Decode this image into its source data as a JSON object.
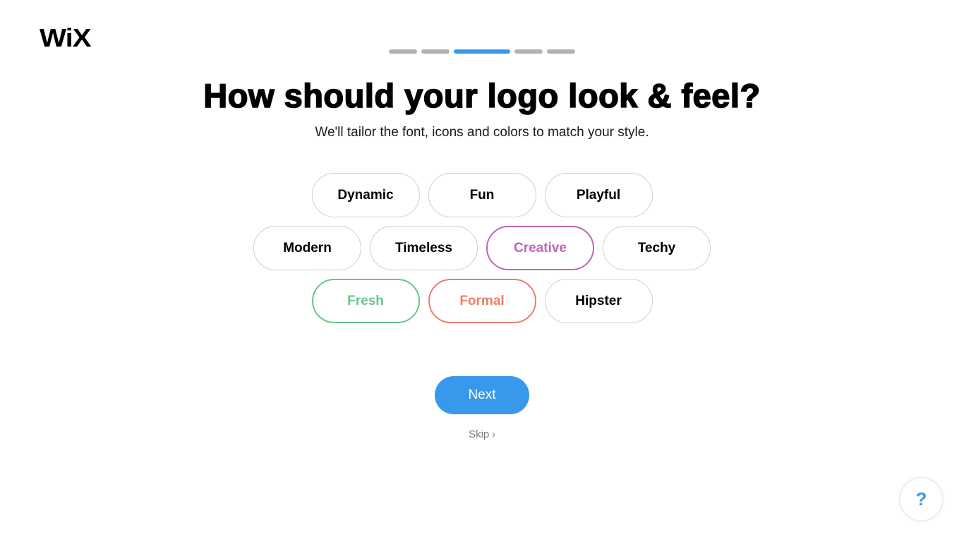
{
  "brand": {
    "logo_text": "WiX"
  },
  "progress": {
    "total_steps": 5,
    "current_step": 3,
    "colors": {
      "active": "#3899ec",
      "inactive": "#b2b2b2"
    }
  },
  "header": {
    "title": "How should your logo look & feel?",
    "subtitle": "We'll tailor the font, icons and colors to match your style."
  },
  "styles": {
    "rows": [
      [
        {
          "label": "Dynamic",
          "selected": false
        },
        {
          "label": "Fun",
          "selected": false
        },
        {
          "label": "Playful",
          "selected": false
        }
      ],
      [
        {
          "label": "Modern",
          "selected": false
        },
        {
          "label": "Timeless",
          "selected": false
        },
        {
          "label": "Creative",
          "selected": true,
          "color": "#c064bc"
        },
        {
          "label": "Techy",
          "selected": false
        }
      ],
      [
        {
          "label": "Fresh",
          "selected": true,
          "color": "#66c68a"
        },
        {
          "label": "Formal",
          "selected": true,
          "color": "#ee7d68"
        },
        {
          "label": "Hipster",
          "selected": false
        }
      ]
    ]
  },
  "actions": {
    "next_label": "Next",
    "skip_label": "Skip",
    "skip_icon": "chevron-right-icon",
    "help_label": "?",
    "accent": "#3899ec"
  }
}
